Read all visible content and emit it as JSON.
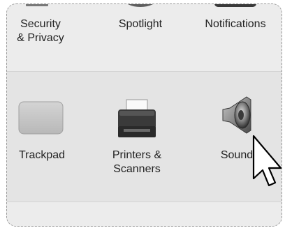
{
  "preferences": {
    "row1": [
      {
        "label": "Security\n& Privacy",
        "icon": "security-privacy-icon"
      },
      {
        "label": "Spotlight",
        "icon": "spotlight-icon"
      },
      {
        "label": "Notifications",
        "icon": "notifications-icon"
      }
    ],
    "row2": [
      {
        "label": "Trackpad",
        "icon": "trackpad-icon"
      },
      {
        "label": "Printers &\nScanners",
        "icon": "printers-scanners-icon"
      },
      {
        "label": "Sound",
        "icon": "sound-icon"
      }
    ]
  },
  "cursor": {
    "icon": "mouse-pointer-icon"
  },
  "colors": {
    "background": "#ececec",
    "row_alt": "#e4e4e4",
    "text": "#222222"
  }
}
